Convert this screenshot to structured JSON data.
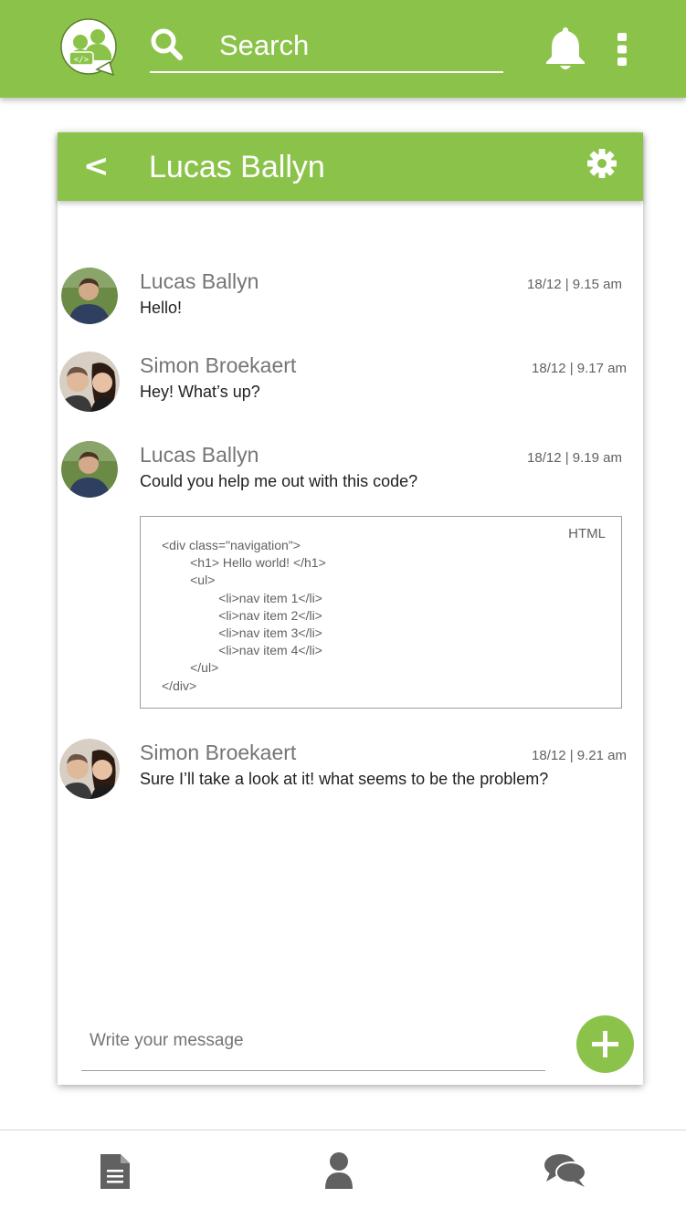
{
  "search": {
    "placeholder": "Search"
  },
  "chat": {
    "title": "Lucas Ballyn",
    "messages": [
      {
        "sender": "Lucas Ballyn",
        "time": "18/12 | 9.15 am",
        "text": "Hello!"
      },
      {
        "sender": "Simon Broekaert",
        "time": "18/12 | 9.17 am",
        "text": "Hey! What’s up?"
      },
      {
        "sender": "Lucas Ballyn",
        "time": "18/12 | 9.19 am",
        "text": "Could you help me out with this code?"
      },
      {
        "sender": "Simon Broekaert",
        "time": "18/12 | 9.21 am",
        "text": "Sure I’ll take a look at it! what seems to be the problem?"
      }
    ],
    "code": {
      "language": "HTML",
      "lines": [
        "<div class=\"navigation\">",
        "        <h1> Hello world! </h1>",
        "        <ul>",
        "                <li>nav item 1</li>",
        "                <li>nav item 2</li>",
        "                <li>nav item 3</li>",
        "                <li>nav item 4</li>",
        "        </ul>",
        "</div>"
      ]
    },
    "compose_placeholder": "Write your message"
  },
  "colors": {
    "accent": "#8bc34a",
    "icon_gray": "#616161"
  },
  "icons": {
    "logo": "chat-group-logo-icon",
    "search": "search-icon",
    "notifications": "bell-icon",
    "menu": "more-vertical-icon",
    "back": "back-chevron-icon",
    "settings": "gear-icon",
    "add": "plus-icon",
    "nav": [
      "document-icon",
      "user-icon",
      "chat-bubbles-icon"
    ]
  }
}
